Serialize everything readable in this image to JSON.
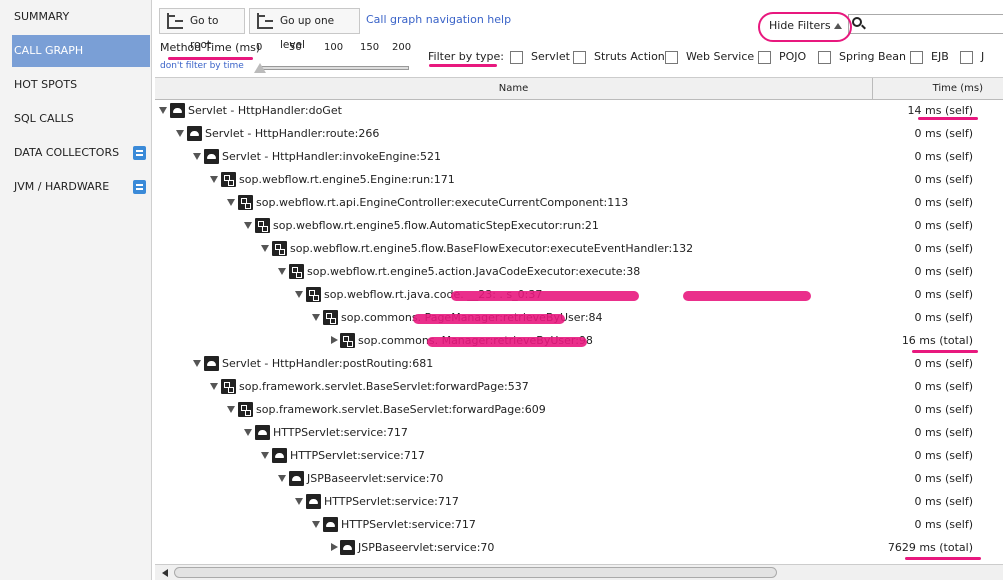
{
  "sidebar": {
    "items": [
      {
        "label": "SUMMARY",
        "active": false
      },
      {
        "label": "CALL GRAPH",
        "active": true
      },
      {
        "label": "HOT SPOTS",
        "active": false
      },
      {
        "label": "SQL CALLS",
        "active": false
      },
      {
        "label": "DATA COLLECTORS",
        "active": false,
        "icon": "list-icon"
      },
      {
        "label": "JVM / HARDWARE",
        "active": false,
        "icon": "list-icon"
      }
    ]
  },
  "toolbar": {
    "go_root_label": "Go to root",
    "go_up_label": "Go up one level",
    "help_link": "Call graph navigation help",
    "hide_filters_label": "Hide Filters",
    "search_value": ""
  },
  "filters": {
    "method_time_label": "Method Time (ms)",
    "no_filter_link": "don't filter by time",
    "ticks": [
      "0",
      "50",
      "100",
      "150",
      "200"
    ],
    "slider_value": 0,
    "filter_by_type_label": "Filter by type:",
    "types": [
      "Servlet",
      "Struts Action",
      "Web Service",
      "POJO",
      "Spring Bean",
      "EJB",
      "J"
    ]
  },
  "table": {
    "col_name": "Name",
    "col_time": "Time (ms)",
    "rows": [
      {
        "label": "Servlet - HttpHandler:doGet",
        "time": "14 ms (self)"
      },
      {
        "label": "Servlet - HttpHandler:route:266",
        "time": "0 ms (self)"
      },
      {
        "label": "Servlet - HttpHandler:invokeEngine:521",
        "time": "0 ms (self)"
      },
      {
        "label": "sop.webflow.rt.engine5.Engine:run:171",
        "time": "0 ms (self)"
      },
      {
        "label": "sop.webflow.rt.api.EngineController:executeCurrentComponent:113",
        "time": "0 ms (self)"
      },
      {
        "label": "sop.webflow.rt.engine5.flow.AutomaticStepExecutor:run:21",
        "time": "0 ms (self)"
      },
      {
        "label": "sop.webflow.rt.engine5.flow.BaseFlowExecutor:executeEventHandler:132",
        "time": "0 ms (self)"
      },
      {
        "label": "sop.webflow.rt.engine5.action.JavaCodeExecutor:execute:38",
        "time": "0 ms (self)"
      },
      {
        "label": "sop.webflow.rt.java.code.                                                      __23:              .           s_0:37",
        "time": "0 ms (self)"
      },
      {
        "label": "sop.commons.                            PageManager:retrieveByUser:84",
        "time": "0 ms (self)"
      },
      {
        "label": "sop.commons.                                       Manager:retrieveByUser:98",
        "time": "16 ms (total)"
      },
      {
        "label": "Servlet - HttpHandler:postRouting:681",
        "time": "0 ms (self)"
      },
      {
        "label": "sop.framework.servlet.BaseServlet:forwardPage:537",
        "time": "0 ms (self)"
      },
      {
        "label": "sop.framework.servlet.BaseServlet:forwardPage:609",
        "time": "0 ms (self)"
      },
      {
        "label": "HTTPServlet:service:717",
        "time": "0 ms (self)"
      },
      {
        "label": "HTTPServlet:service:717",
        "time": "0 ms (self)"
      },
      {
        "label": "JSPBaseervlet:service:70",
        "time": "0 ms (self)"
      },
      {
        "label": "HTTPServlet:service:717",
        "time": "0 ms (self)"
      },
      {
        "label": "HTTPServlet:service:717",
        "time": "0 ms (self)"
      },
      {
        "label": "JSPBaseervlet:service:70",
        "time": "7629 ms (total)"
      }
    ]
  },
  "colors": {
    "accent": "#7a9fd6",
    "annotation": "#e8187e",
    "link": "#3a63c8"
  }
}
